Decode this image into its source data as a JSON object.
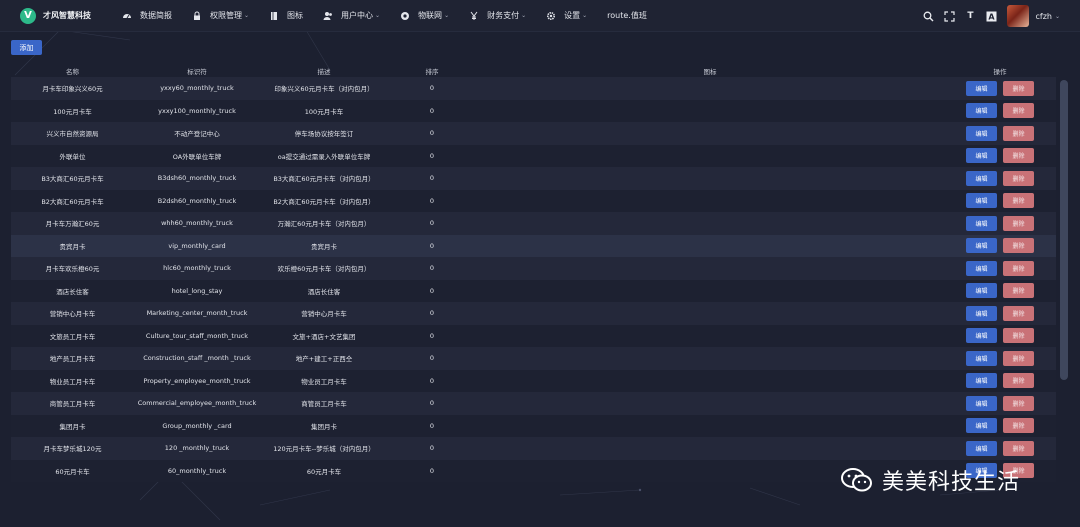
{
  "app": {
    "brand_name": "才风智慧科技",
    "brand_initial": "V"
  },
  "nav": {
    "items": [
      {
        "label": "数据简报",
        "icon": "dashboard-icon",
        "has_dropdown": false
      },
      {
        "label": "权限管理",
        "icon": "lock-icon",
        "has_dropdown": true
      },
      {
        "label": "图标",
        "icon": "book-icon",
        "has_dropdown": false
      },
      {
        "label": "用户中心",
        "icon": "users-icon",
        "has_dropdown": true
      },
      {
        "label": "物联网",
        "icon": "globe-icon",
        "has_dropdown": true
      },
      {
        "label": "财务支付",
        "icon": "yen-icon",
        "has_dropdown": true
      },
      {
        "label": "设置",
        "icon": "gear-icon",
        "has_dropdown": true
      },
      {
        "label": "route.值班",
        "icon": "",
        "has_dropdown": false
      }
    ],
    "chevron": "⌄"
  },
  "tools": {
    "font_size_glyph": "T",
    "translate_glyph": "A"
  },
  "user": {
    "name": "cfzh"
  },
  "toolbar": {
    "add_label": "添加"
  },
  "table": {
    "headers": {
      "name": "名称",
      "identifier": "标识符",
      "description": "描述",
      "sort": "排序",
      "icon": "图标",
      "actions": "操作"
    },
    "edit_label": "编辑",
    "delete_label": "删除",
    "rows": [
      {
        "name": "月卡车印象兴义60元",
        "identifier": "yxxy60_monthly_truck",
        "description": "印象兴义60元月卡车（对内包月）",
        "sort": "0"
      },
      {
        "name": "100元月卡车",
        "identifier": "yxxy100_monthly_truck",
        "description": "100元月卡车",
        "sort": "0"
      },
      {
        "name": "兴义市自然资源局",
        "identifier": "不动产登记中心",
        "description": "停车场协议按年签订",
        "sort": "0"
      },
      {
        "name": "外联单位",
        "identifier": "OA外联单位车牌",
        "description": "oa提交通过需录入外联单位车牌",
        "sort": "0"
      },
      {
        "name": "B3大商汇60元月卡车",
        "identifier": "B3dsh60_monthly_truck",
        "description": "B3大商汇60元月卡车（对内包月）",
        "sort": "0"
      },
      {
        "name": "B2大商汇60元月卡车",
        "identifier": "B2dsh60_monthly_truck",
        "description": "B2大商汇60元月卡车（对内包月）",
        "sort": "0"
      },
      {
        "name": "月卡车万瀚汇60元",
        "identifier": "whh60_monthly_truck",
        "description": "万瀚汇60元月卡车（对内包月）",
        "sort": "0"
      },
      {
        "name": "贵宾月卡",
        "identifier": "vip_monthly_card",
        "description": "贵宾月卡",
        "sort": "0"
      },
      {
        "name": "月卡车欢乐橙60元",
        "identifier": "hlc60_monthly_truck",
        "description": "欢乐橙60元月卡车（对内包月）",
        "sort": "0"
      },
      {
        "name": "酒店长住客",
        "identifier": "hotel_long_stay",
        "description": "酒店长住客",
        "sort": "0"
      },
      {
        "name": "营销中心月卡车",
        "identifier": "Marketing_center_month_truck",
        "description": "营销中心月卡车",
        "sort": "0"
      },
      {
        "name": "文旅员工月卡车",
        "identifier": "Culture_tour_staff_month_truck",
        "description": "文旅+酒店+文艺集团",
        "sort": "0"
      },
      {
        "name": "地产员工月卡车",
        "identifier": "Construction_staff _month _truck",
        "description": "地产+建工+正西仝",
        "sort": "0"
      },
      {
        "name": "物业员工月卡车",
        "identifier": "Property_employee_month_truck",
        "description": "物业员工月卡车",
        "sort": "0"
      },
      {
        "name": "商管员工月卡车",
        "identifier": "Commercial_employee_month_truck",
        "description": "商管员工月卡车",
        "sort": "0"
      },
      {
        "name": "集团月卡",
        "identifier": "Group_monthly _card",
        "description": "集团月卡",
        "sort": "0"
      },
      {
        "name": "月卡车梦乐城120元",
        "identifier": "120 _monthly_truck",
        "description": "120元月卡车--梦乐城（对内包月）",
        "sort": "0"
      },
      {
        "name": "60元月卡车",
        "identifier": "60_monthly_truck",
        "description": "60元月卡车",
        "sort": "0"
      }
    ]
  },
  "watermark": {
    "text": "美美科技生活"
  },
  "colors": {
    "background": "#1c2030",
    "primary": "#3a66c8",
    "danger": "#c97277",
    "brand": "#2db98a"
  }
}
